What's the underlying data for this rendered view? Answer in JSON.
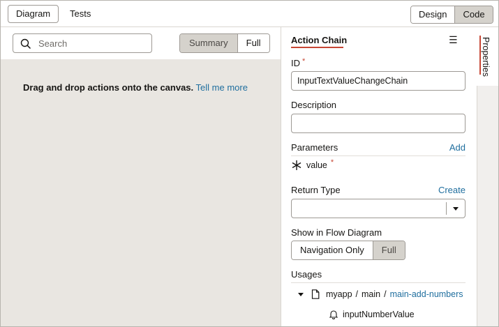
{
  "topbar": {
    "tabs": [
      {
        "label": "Diagram",
        "active": true
      },
      {
        "label": "Tests",
        "active": false
      }
    ],
    "view_toggle": {
      "design": "Design",
      "code": "Code",
      "selected": "Code"
    }
  },
  "canvas": {
    "search_placeholder": "Search",
    "detail_toggle": {
      "summary": "Summary",
      "full": "Full",
      "selected": "Summary"
    },
    "empty_message": "Drag and drop actions onto the canvas.",
    "tell_me_more": "Tell me more"
  },
  "panel": {
    "title": "Action Chain",
    "id_label": "ID",
    "required_mark": "*",
    "id_value": "InputTextValueChangeChain",
    "description_label": "Description",
    "description_value": "",
    "parameters_label": "Parameters",
    "add_link": "Add",
    "parameter_name": "value",
    "return_type_label": "Return Type",
    "create_link": "Create",
    "return_type_value": "",
    "flow_label": "Show in Flow Diagram",
    "flow_toggle": {
      "navigation": "Navigation Only",
      "full": "Full",
      "selected": "Full"
    },
    "usages_label": "Usages",
    "usage_path": {
      "app": "myapp",
      "sep": "/",
      "flow": "main",
      "page": "main-add-numbers"
    },
    "usage_event": "inputNumberValue"
  },
  "side_tab": {
    "label": "Properties"
  },
  "colors": {
    "accent": "#c74634",
    "link": "#1f6e9e",
    "canvas": "#e9e6e1",
    "selected": "#d5d2cc"
  }
}
